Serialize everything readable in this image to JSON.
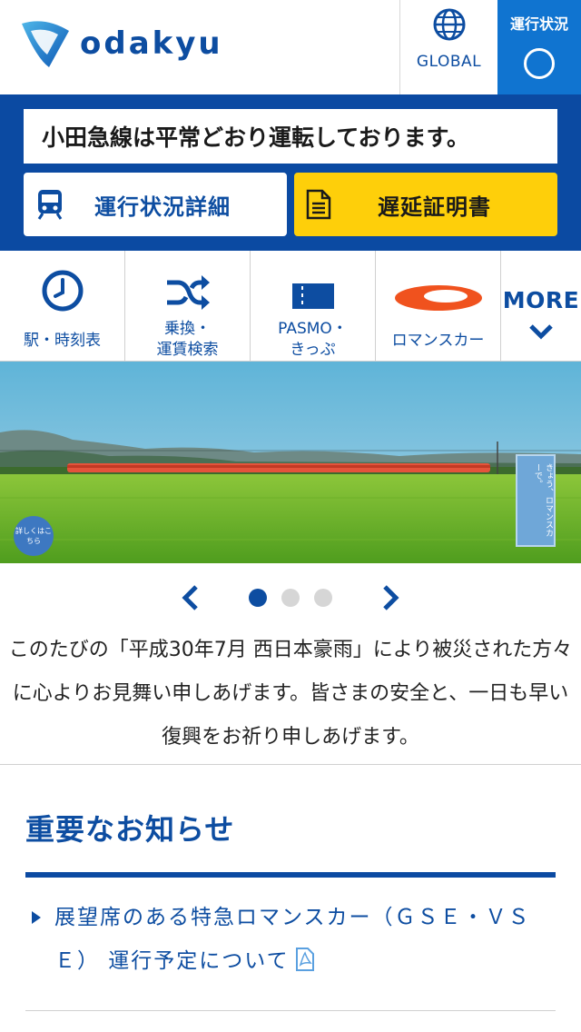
{
  "header": {
    "logo_text": "odakyu",
    "global_label": "GLOBAL",
    "status_label": "運行状況"
  },
  "operation": {
    "message": "小田急線は平常どおり運転しております。",
    "detail_label": "運行状況詳細",
    "certificate_label": "遅延証明書"
  },
  "quicknav": {
    "items": [
      {
        "label_line1": "駅・時刻表",
        "label_line2": "",
        "icon": "clock-icon"
      },
      {
        "label_line1": "乗換・",
        "label_line2": "運賃検索",
        "icon": "shuffle-icon"
      },
      {
        "label_line1": "PASMO・",
        "label_line2": "きっぷ",
        "icon": "ticket-icon"
      },
      {
        "label_line1": "ロマンスカー",
        "label_line2": "",
        "icon": "romancecar-icon"
      }
    ],
    "more_label": "MORE"
  },
  "banner": {
    "badge_text": "詳しくはこちら",
    "tag_text": "きょう、ロマンスカーで。"
  },
  "carousel": {
    "slide_count": 3,
    "active_index": 0
  },
  "message": "このたびの「平成30年7月 西日本豪雨」により被災された方々に心よりお見舞い申しあげます。皆さまの安全と、一日も早い復興をお祈り申しあげます。",
  "notice": {
    "title": "重要なお知らせ",
    "items": [
      {
        "text": "展望席のある特急ロマンスカー（ＧＳＥ・ＶＳＥ） 運行予定について",
        "has_pdf": true
      }
    ]
  },
  "colors": {
    "brand_blue": "#0b4aa2",
    "status_blue": "#1074d0",
    "cert_yellow": "#fecf0a",
    "romancecar_orange": "#f0521e"
  }
}
